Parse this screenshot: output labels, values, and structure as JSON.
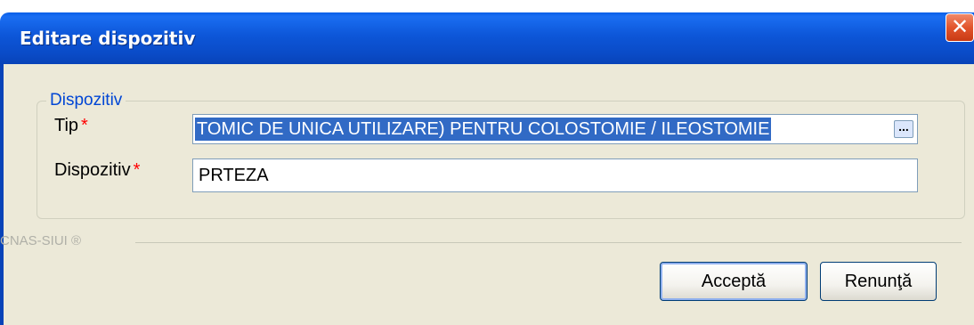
{
  "window": {
    "title": "Editare dispozitiv",
    "close_glyph": "✕"
  },
  "group": {
    "legend": "Dispozitiv",
    "tip": {
      "label": "Tip",
      "required_mark": "*",
      "value": "TOMIC DE UNICA UTILIZARE) PENTRU COLOSTOMIE / ILEOSTOMIE",
      "browse_label": "..."
    },
    "dispozitiv": {
      "label": "Dispozitiv",
      "required_mark": "*",
      "value": "PRTEZA"
    }
  },
  "footer": {
    "brand": "CNAS-SIUI ®",
    "accept_label": "Acceptă",
    "cancel_label": "Renunţă"
  },
  "colors": {
    "titlebar": "#0a4bc7",
    "selection": "#316ac5",
    "legend": "#0046d5",
    "required": "#ff0000",
    "dialog_bg": "#ece9d8"
  }
}
